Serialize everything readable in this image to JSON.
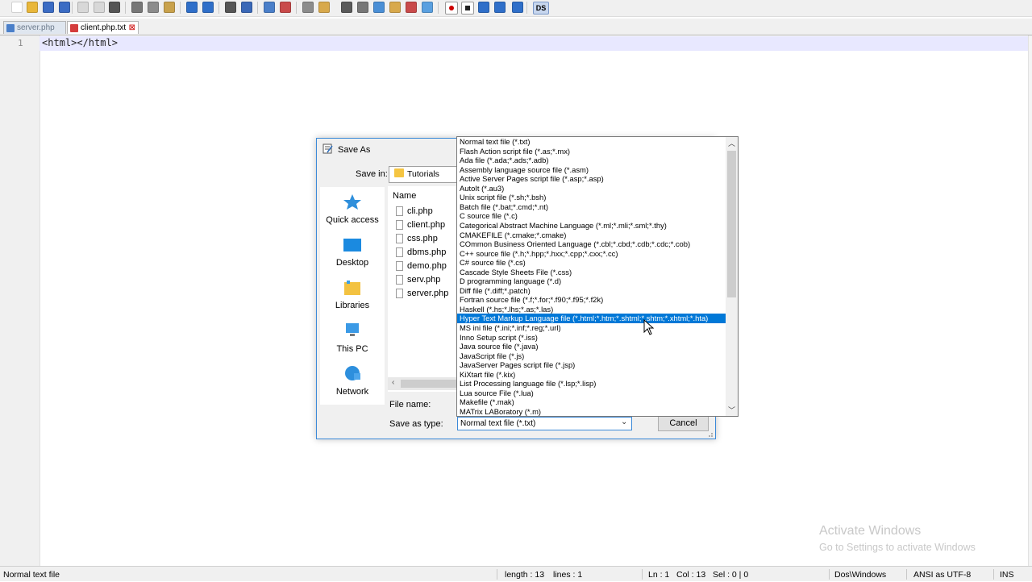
{
  "toolbar": {
    "icons": [
      "new-file-icon",
      "open-file-icon",
      "save-icon",
      "save-all-icon",
      "close-icon",
      "close-all-icon",
      "print-icon",
      "cut-icon",
      "copy-icon",
      "paste-icon",
      "undo-icon",
      "redo-icon",
      "find-icon",
      "replace-icon",
      "zoom-in-icon",
      "zoom-out-icon",
      "sync-vertical-icon",
      "sync-horizontal-icon",
      "word-wrap-icon",
      "show-all-chars-icon",
      "indent-guide-icon",
      "doc-map-icon",
      "function-list-icon",
      "folder-workspace-icon",
      "record-macro-icon",
      "stop-macro-icon",
      "play-macro-icon",
      "run-macro-multiple-icon",
      "save-macro-icon",
      "ds-plugin-icon"
    ],
    "ds_label": "DS"
  },
  "tabs": [
    {
      "label": "server.php",
      "close": "⊠"
    },
    {
      "label": "client.php.txt",
      "close": "⊠"
    }
  ],
  "editor": {
    "line_number": "1",
    "code": "<html></html>"
  },
  "dialog": {
    "title": "Save As",
    "save_in_label": "Save in:",
    "save_in_value": "Tutorials",
    "places": [
      "Quick access",
      "Desktop",
      "Libraries",
      "This PC",
      "Network"
    ],
    "name_header": "Name",
    "files": [
      "cli.php",
      "client.php",
      "css.php",
      "dbms.php",
      "demo.php",
      "serv.php",
      "server.php"
    ],
    "file_name_label": "File name:",
    "save_as_type_label": "Save as type:",
    "save_as_type_value": "Normal text file (*.txt)",
    "cancel_label": "Cancel",
    "type_options": [
      "Normal text file (*.txt)",
      "Flash Action script file (*.as;*.mx)",
      "Ada file (*.ada;*.ads;*.adb)",
      "Assembly language source file (*.asm)",
      "Active Server Pages script file (*.asp;*.asp)",
      "AutoIt (*.au3)",
      "Unix script file (*.sh;*.bsh)",
      "Batch file (*.bat;*.cmd;*.nt)",
      "C source file (*.c)",
      "Categorical Abstract Machine Language (*.ml;*.mli;*.sml;*.thy)",
      "CMAKEFILE (*.cmake;*.cmake)",
      "COmmon Business Oriented Language (*.cbl;*.cbd;*.cdb;*.cdc;*.cob)",
      "C++ source file (*.h;*.hpp;*.hxx;*.cpp;*.cxx;*.cc)",
      "C# source file (*.cs)",
      "Cascade Style Sheets File (*.css)",
      "D programming language (*.d)",
      "Diff file (*.diff;*.patch)",
      "Fortran source file (*.f;*.for;*.f90;*.f95;*.f2k)",
      "Haskell (*.hs;*.lhs;*.as;*.las)",
      "Hyper Text Markup Language file (*.html;*.htm;*.shtml;*.shtm;*.xhtml;*.hta)",
      "MS ini file (*.ini;*.inf;*.reg;*.url)",
      "Inno Setup script (*.iss)",
      "Java source file (*.java)",
      "JavaScript file (*.js)",
      "JavaServer Pages script file (*.jsp)",
      "KiXtart file (*.kix)",
      "List Processing language file (*.lsp;*.lisp)",
      "Lua source File (*.lua)",
      "Makefile (*.mak)",
      "MATrix LABoratory (*.m)"
    ],
    "selected_index": 19
  },
  "statusbar": {
    "file_type": "Normal text file",
    "length": "length : 13",
    "lines": "lines : 1",
    "ln": "Ln : 1",
    "col": "Col : 13",
    "sel": "Sel : 0 | 0",
    "eol": "Dos\\Windows",
    "encoding": "ANSI as UTF-8",
    "mode": "INS"
  },
  "watermark": {
    "line1": "Activate Windows",
    "line2": "Go to Settings to activate Windows"
  },
  "colors": {
    "accent": "#0078d7",
    "dialog_border": "#3c8ad8",
    "current_line": "#e8e8ff"
  }
}
